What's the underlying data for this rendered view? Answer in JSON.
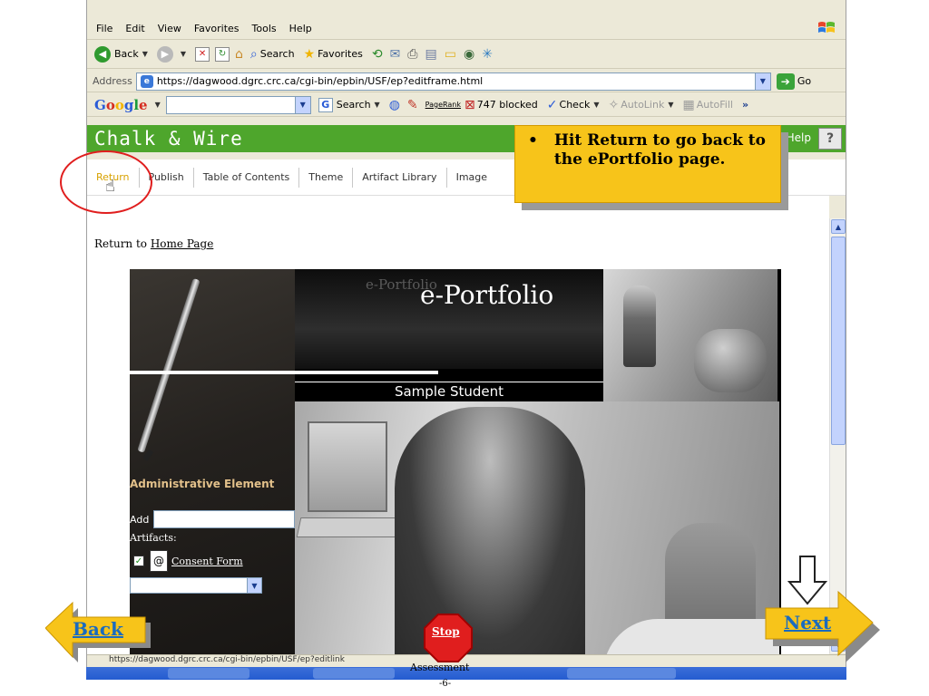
{
  "browser": {
    "menu": [
      "File",
      "Edit",
      "View",
      "Favorites",
      "Tools",
      "Help"
    ],
    "toolbar": {
      "back_label": "Back",
      "search_label": "Search",
      "favorites_label": "Favorites"
    },
    "address": {
      "label": "Address",
      "url": "https://dagwood.dgrc.crc.ca/cgi-bin/epbin/USF/ep?editframe.html",
      "go_label": "Go"
    },
    "google_bar": {
      "logo": [
        "G",
        "o",
        "o",
        "g",
        "l",
        "e"
      ],
      "search_label": "Search",
      "pagerank_label": "PageRank",
      "blocked_label": "747 blocked",
      "check_label": "Check",
      "autolink_label": "AutoLink",
      "autofill_label": "AutoFill",
      "more_label": "»"
    },
    "status_text": "https://dagwood.dgrc.crc.ca/cgi-bin/epbin/USF/ep?editlink"
  },
  "app": {
    "title": "Chalk & Wire",
    "help_label": "Help",
    "help_icon": "?",
    "tabs": [
      {
        "label": "Return",
        "active": true
      },
      {
        "label": "Publish",
        "active": false
      },
      {
        "label": "Table of Contents",
        "active": false
      },
      {
        "label": "Theme",
        "active": false
      },
      {
        "label": "Artifact Library",
        "active": false
      },
      {
        "label": "Image",
        "active": false
      }
    ]
  },
  "page": {
    "return_prefix": "Return to",
    "return_link": "Home Page",
    "portfolio": {
      "watermark": "e-Portfolio",
      "title": "e-Portfolio",
      "student_name": "Sample Student",
      "admin_heading": "Administrative Element",
      "add_label": "Add",
      "artifacts_label": "Artifacts:",
      "consent_label": "Consent Form",
      "at_icon": "@"
    }
  },
  "annotation": {
    "bullet": "•",
    "text": "Hit Return to go back to the ePortfolio page."
  },
  "slide_nav": {
    "back_label": "Back",
    "next_label": "Next",
    "stop_label": "Stop"
  },
  "footer": {
    "title": "Assessment",
    "page": "-6-"
  },
  "colors": {
    "header_green": "#4ea62c",
    "callout_yellow": "#f7c41a",
    "nav_link_blue": "#1a6bbf",
    "stop_red": "#e01e1e"
  }
}
